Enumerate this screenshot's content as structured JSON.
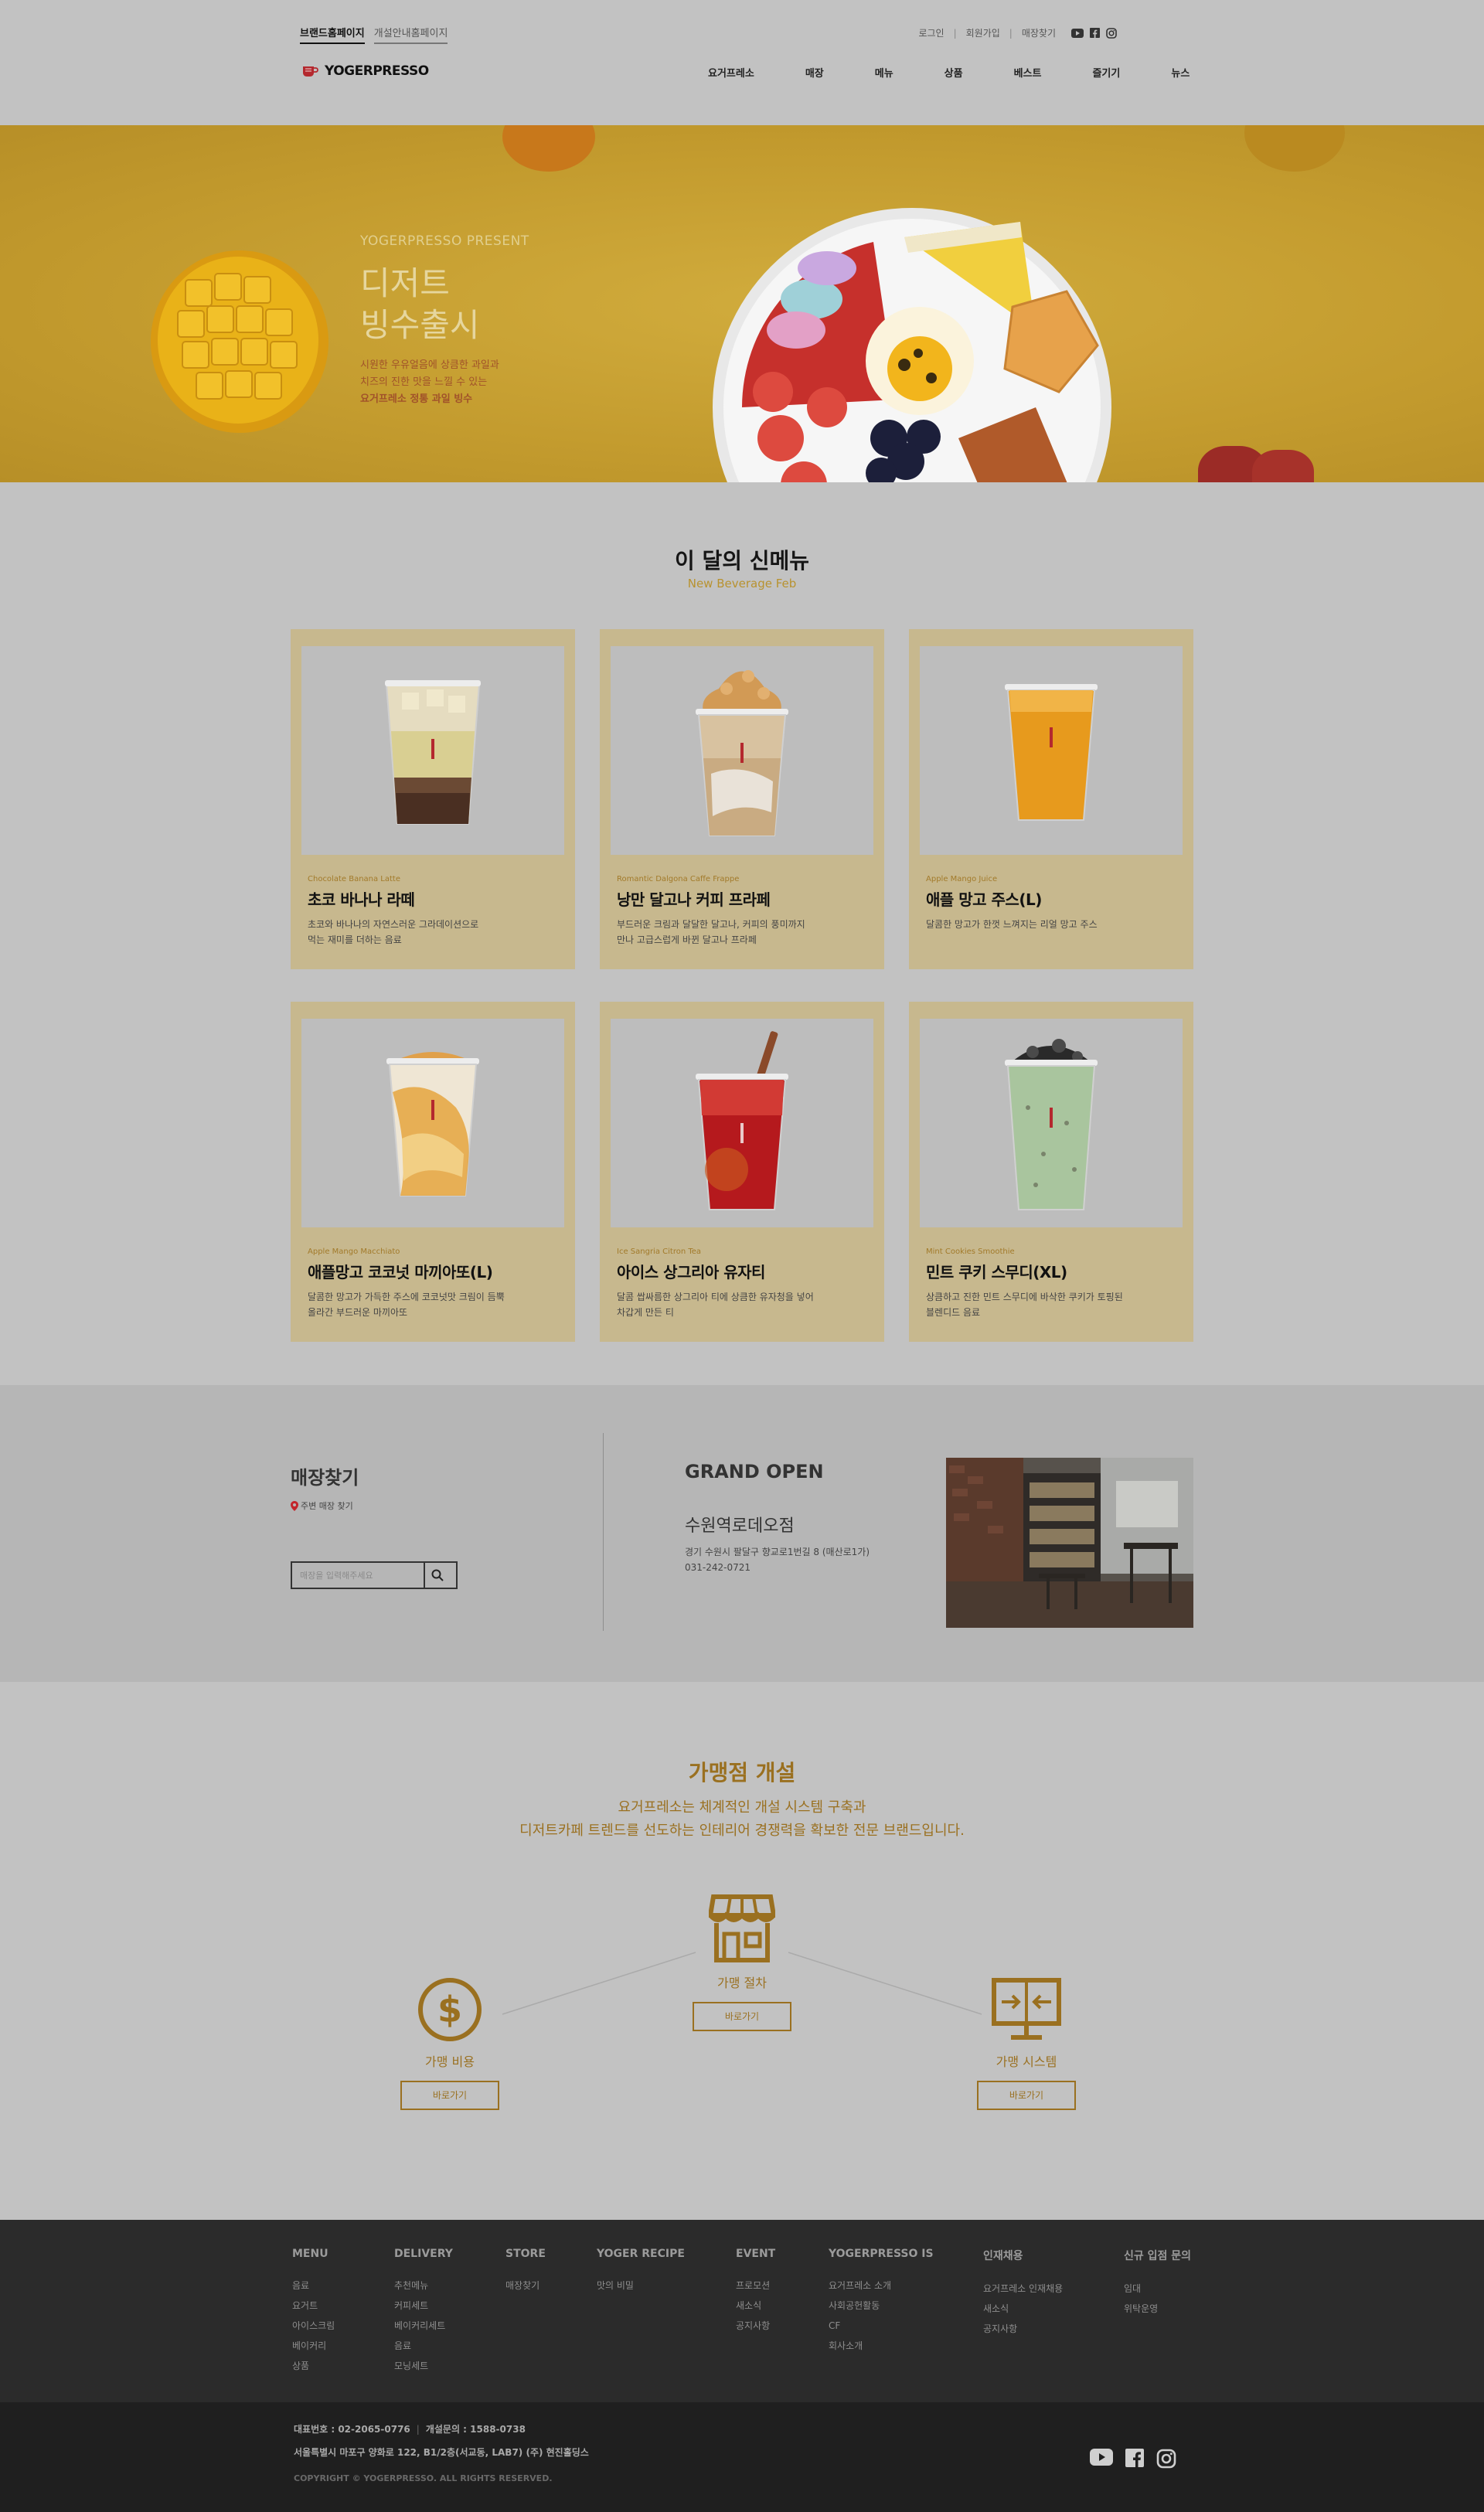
{
  "header": {
    "brand_tabs": [
      "브랜드홈페이지",
      "개설안내홈페이지"
    ],
    "util_links": [
      "로그인",
      "회원가입",
      "매장찾기"
    ],
    "logo_text": "YOGERPRESSO",
    "nav": [
      "요거프레소",
      "매장",
      "메뉴",
      "상품",
      "베스트",
      "즐기기",
      "뉴스"
    ]
  },
  "hero": {
    "eyebrow": "YOGERPRESSO PRESENT",
    "title_line1": "디저트",
    "title_line2": "빙수출시",
    "desc_line1": "시원한 우유얼음에 상큼한 과일과",
    "desc_line2": "치즈의 진한 맛을 느낄 수 있는",
    "desc_line3": "요거프레소 정통 과일 빙수"
  },
  "new_menu": {
    "title": "이 달의 신메뉴",
    "subtitle": "New Beverage Feb",
    "items": [
      {
        "en": "Chocolate Banana Latte",
        "ko": "초코 바나나 라떼",
        "desc1": "초코와 바나나의 자연스러운 그라데이션으로",
        "desc2": "먹는 재미를 더하는 음료"
      },
      {
        "en": "Romantic Dalgona Caffe Frappe",
        "ko": "낭만 달고나 커피 프라페",
        "desc1": "부드러운 크림과 달달한 달고나, 커피의 풍미까지",
        "desc2": "만나 고급스럽게 바뀐 달고나 프라페"
      },
      {
        "en": "Apple Mango Juice",
        "ko": "애플 망고 주스(L)",
        "desc1": "달콤한 망고가 한껏 느껴지는 리얼 망고 주스",
        "desc2": ""
      },
      {
        "en": "Apple Mango Macchiato",
        "ko": "애플망고 코코넛 마끼아또(L)",
        "desc1": "달콤한 망고가 가득한 주스에 코코넛맛 크림이 듬뿍",
        "desc2": "올라간 부드러운 마끼아또"
      },
      {
        "en": "Ice Sangria Citron Tea",
        "ko": "아이스 상그리아 유자티",
        "desc1": "달콤 쌉싸름한 상그리아 티에 상큼한 유자청을 넣어",
        "desc2": "차갑게 만든 티"
      },
      {
        "en": "Mint Cookies Smoothie",
        "ko": "민트 쿠키 스무디(XL)",
        "desc1": "상큼하고 진한 민트 스무디에 바삭한 쿠키가 토핑된",
        "desc2": "블렌디드 음료"
      }
    ]
  },
  "store": {
    "title": "매장찾기",
    "near_label": "주변 매장 찾기",
    "search_placeholder": "매장을 입력해주세요",
    "grand_open_title": "GRAND OPEN",
    "store_name": "수원역로데오점",
    "address": "경기 수원시 팔달구 향교로1번길 8 (매산로1가)",
    "phone": "031-242-0721"
  },
  "franchise": {
    "title": "가맹점 개설",
    "desc_line1": "요거프레소는 체계적인 개설 시스템 구축과",
    "desc_line2": "디저트카페 트렌드를 선도하는 인테리어 경쟁력을 확보한 전문 브랜드입니다.",
    "items": [
      {
        "label": "가맹 비용",
        "button": "바로가기",
        "icon": "dollar-icon"
      },
      {
        "label": "가맹 절차",
        "button": "바로가기",
        "icon": "store-icon"
      },
      {
        "label": "가맹 시스템",
        "button": "바로가기",
        "icon": "monitor-icon"
      }
    ]
  },
  "footer": {
    "columns": [
      {
        "title": "MENU",
        "items": [
          "음료",
          "요거트",
          "아이스크림",
          "베이커리",
          "상품"
        ]
      },
      {
        "title": "DELIVERY",
        "items": [
          "추천메뉴",
          "커피세트",
          "베이커리세트",
          "음료",
          "모닝세트"
        ]
      },
      {
        "title": "STORE",
        "items": [
          "매장찾기"
        ]
      },
      {
        "title": "YOGER RECIPE",
        "items": [
          "맛의 비밀"
        ]
      },
      {
        "title": "EVENT",
        "items": [
          "프로모션",
          "새소식",
          "공지사항"
        ]
      },
      {
        "title": "YOGERPRESSO IS",
        "items": [
          "요거프레소 소개",
          "사회공헌활동",
          "CF",
          "회사소개"
        ]
      },
      {
        "title": "인재채용",
        "items": [
          "요거프레소 인재채용",
          "새소식",
          "공지사항"
        ]
      },
      {
        "title": "신규 입점 문의",
        "items": [
          "임대",
          "위탁운영"
        ]
      }
    ],
    "rep_phone": "대표번호 : 02-2065-0776",
    "open_phone": "개설문의 : 1588-0738",
    "address": "서울특별시 마포구 양화로 122, B1/2층(서교동, LAB7) (주) 현진홀딩스",
    "copyright": "COPYRIGHT © YOGERPRESSO. ALL RIGHTS RESERVED."
  }
}
